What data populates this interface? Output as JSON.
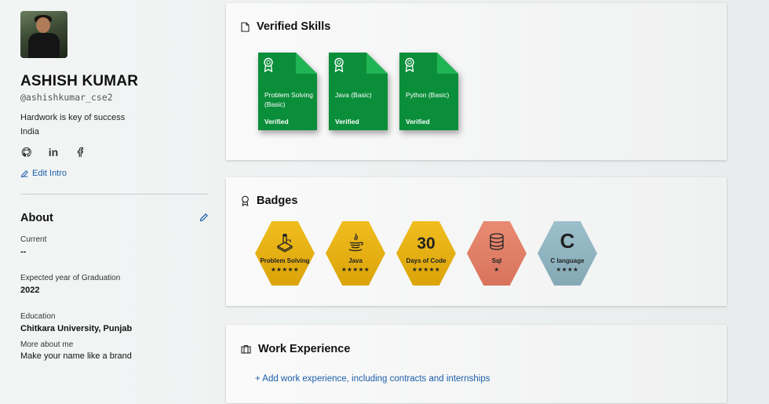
{
  "profile": {
    "name": "ASHISH KUMAR",
    "handle": "@ashishkumar_cse2",
    "tagline": "Hardwork is key of success",
    "country": "India",
    "edit_intro": "Edit Intro",
    "social_icons": [
      "github-icon",
      "linkedin-icon",
      "facebook-icon"
    ]
  },
  "about": {
    "title": "About",
    "fields": [
      {
        "label": "Current",
        "value": "--"
      },
      {
        "label": "Expected year of Graduation",
        "value": "2022"
      },
      {
        "label": "Education",
        "value": "Chitkara University, Punjab"
      },
      {
        "label": "More about me",
        "value": "Make your name like a brand"
      }
    ]
  },
  "skills": {
    "title": "Verified Skills",
    "items": [
      {
        "name": "Problem Solving (Basic)",
        "status": "Verified"
      },
      {
        "name": "Java (Basic)",
        "status": "Verified"
      },
      {
        "name": "Python (Basic)",
        "status": "Verified"
      }
    ]
  },
  "badges": {
    "title": "Badges",
    "items": [
      {
        "label": "Problem Solving",
        "stars": 5,
        "icon": "problem-solving-icon"
      },
      {
        "label": "Java",
        "stars": 5,
        "icon": "java-icon"
      },
      {
        "label": "Days of Code",
        "stars": 5,
        "text": "30"
      },
      {
        "label": "Sql",
        "stars": 1,
        "icon": "database-icon"
      },
      {
        "label": "C language",
        "stars": 4,
        "text": "C"
      }
    ]
  },
  "work": {
    "title": "Work Experience",
    "add_label": "+ Add work experience, including contracts and internships"
  },
  "colors": {
    "accent_link": "#1b5ea8",
    "skill_green": "#0a8e3a",
    "badge_gold": "#e3ac10",
    "badge_salmon": "#e0806a",
    "badge_blue": "#8fb4c0"
  }
}
